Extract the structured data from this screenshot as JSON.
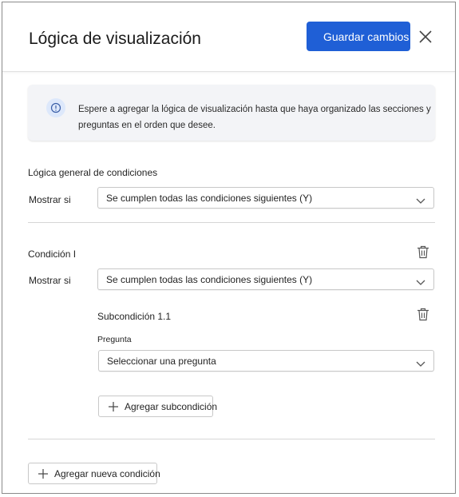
{
  "header": {
    "title": "Lógica de visualización",
    "save_label": "Guardar cambios",
    "close_icon": "close-icon"
  },
  "info": {
    "icon": "info-icon",
    "text": "Espere a agregar la lógica de visualización hasta que haya organizado las secciones y preguntas en el orden que desee."
  },
  "general": {
    "heading": "Lógica general de condiciones",
    "show_if_label": "Mostrar si",
    "show_if_value": "Se cumplen todas las condiciones siguientes (Y)"
  },
  "condition": {
    "heading": "Condición I",
    "show_if_label": "Mostrar si",
    "show_if_value": "Se cumplen todas las condiciones siguientes (Y)",
    "delete_icon": "trash-icon",
    "subcondition": {
      "heading": "Subcondición 1.1",
      "question_label": "Pregunta",
      "question_placeholder": "Seleccionar una pregunta",
      "delete_icon": "trash-icon"
    },
    "add_subcondition_label": "Agregar subcondición"
  },
  "add_condition_label": "Agregar nueva condición",
  "colors": {
    "primary": "#1f5fd6",
    "info_background": "#f3f4f7"
  }
}
